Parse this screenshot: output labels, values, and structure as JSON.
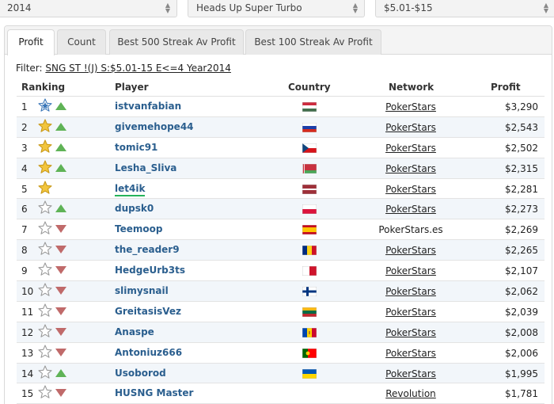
{
  "selects": {
    "year": "2014",
    "game_type": "Heads Up Super Turbo",
    "stake": "$5.01-$15"
  },
  "tabs": [
    {
      "label": "Profit",
      "active": true
    },
    {
      "label": "Count",
      "active": false
    },
    {
      "label": "Best 500 Streak Av Profit",
      "active": false
    },
    {
      "label": "Best 100 Streak Av Profit",
      "active": false
    }
  ],
  "filter": {
    "label": "Filter:",
    "value": "SNG ST !(J) S:$5.01-15 E<=4 Year2014"
  },
  "table": {
    "headers": {
      "ranking": "Ranking",
      "player": "Player",
      "country": "Country",
      "network": "Network",
      "profit": "Profit"
    },
    "rows": [
      {
        "rank": "1",
        "star": "blue",
        "trend": "up",
        "player": "istvanfabian",
        "country": "hungary-flag",
        "network": "PokerStars",
        "network_link": true,
        "profit": "$3,290"
      },
      {
        "rank": "2",
        "star": "gold",
        "trend": "up",
        "player": "givemehope44",
        "country": "russia-flag",
        "network": "PokerStars",
        "network_link": true,
        "profit": "$2,543"
      },
      {
        "rank": "3",
        "star": "gold",
        "trend": "up",
        "player": "tomic91",
        "country": "czech-flag",
        "network": "PokerStars",
        "network_link": true,
        "profit": "$2,502"
      },
      {
        "rank": "4",
        "star": "gold",
        "trend": "up",
        "player": "Lesha_Sliva",
        "country": "belarus-flag",
        "network": "PokerStars",
        "network_link": true,
        "profit": "$2,315"
      },
      {
        "rank": "5",
        "star": "gold",
        "trend": "none",
        "player": "let4ik",
        "country": "latvia-flag",
        "network": "PokerStars",
        "network_link": true,
        "profit": "$2,281",
        "highlight": true
      },
      {
        "rank": "6",
        "star": "grey",
        "trend": "up",
        "player": "dupsk0",
        "country": "poland-flag",
        "network": "PokerStars",
        "network_link": true,
        "profit": "$2,273"
      },
      {
        "rank": "7",
        "star": "grey",
        "trend": "down",
        "player": "Teemoop",
        "country": "spain-flag",
        "network": "PokerStars.es",
        "network_link": false,
        "profit": "$2,269"
      },
      {
        "rank": "8",
        "star": "grey",
        "trend": "down",
        "player": "the_reader9",
        "country": "romania-flag",
        "network": "PokerStars",
        "network_link": true,
        "profit": "$2,265"
      },
      {
        "rank": "9",
        "star": "grey",
        "trend": "down",
        "player": "HedgeUrb3ts",
        "country": "malta-flag",
        "network": "PokerStars",
        "network_link": true,
        "profit": "$2,107"
      },
      {
        "rank": "10",
        "star": "grey",
        "trend": "down",
        "player": "slimysnail",
        "country": "finland-flag",
        "network": "PokerStars",
        "network_link": true,
        "profit": "$2,062"
      },
      {
        "rank": "11",
        "star": "grey",
        "trend": "down",
        "player": "GreitasisVez",
        "country": "lithuania-flag",
        "network": "PokerStars",
        "network_link": true,
        "profit": "$2,039"
      },
      {
        "rank": "12",
        "star": "grey",
        "trend": "down",
        "player": "Anaspe",
        "country": "moldova-flag",
        "network": "PokerStars",
        "network_link": true,
        "profit": "$2,008"
      },
      {
        "rank": "13",
        "star": "grey",
        "trend": "down",
        "player": "Antoniuz666",
        "country": "portugal-flag",
        "network": "PokerStars",
        "network_link": true,
        "profit": "$2,006"
      },
      {
        "rank": "14",
        "star": "grey",
        "trend": "up",
        "player": "Usoborod",
        "country": "ukraine-flag",
        "network": "PokerStars",
        "network_link": true,
        "profit": "$1,995"
      },
      {
        "rank": "15",
        "star": "grey",
        "trend": "down",
        "player": "HUSNG Master",
        "country": "none",
        "network": "Revolution",
        "network_link": true,
        "profit": "$1,781"
      }
    ]
  },
  "colors": {
    "player_link": "#2a5e8e",
    "trend_up": "#5fb356",
    "trend_down": "#c06a6a",
    "star_gold": "#f2c53d",
    "star_blue": "#3b77b8",
    "highlight_underline": "#26b35a"
  }
}
